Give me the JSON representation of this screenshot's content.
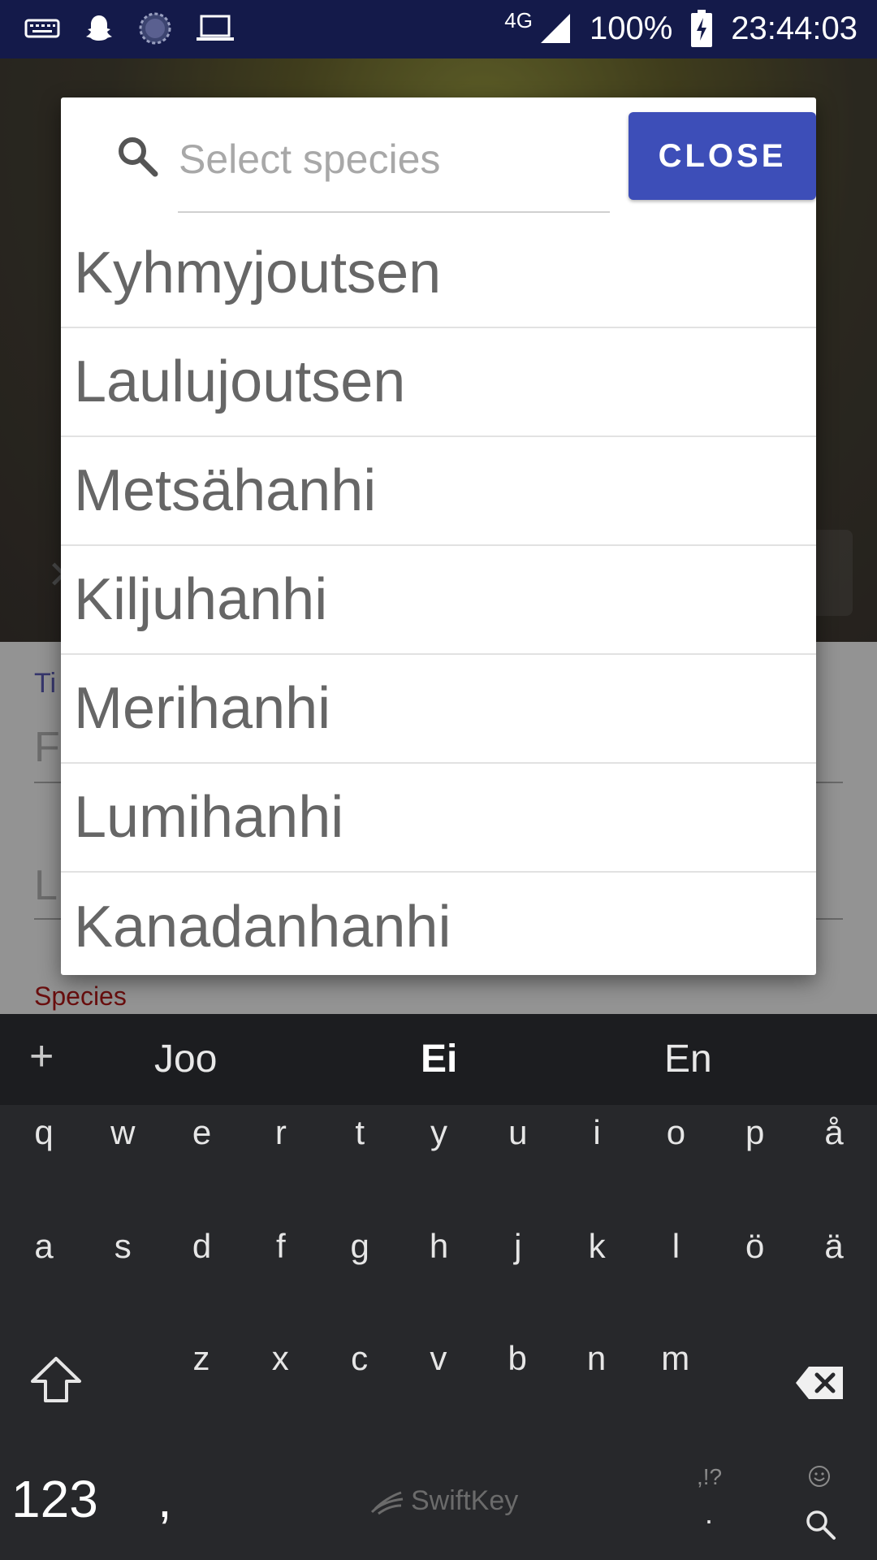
{
  "status_bar": {
    "icons_left": [
      "keyboard-icon",
      "snapchat-icon",
      "loading-icon",
      "laptop-icon"
    ],
    "network": "4G",
    "battery": "100%",
    "time": "23:44:03"
  },
  "background": {
    "form_label": "Ti",
    "field1_partial": "F",
    "field2_partial": "L",
    "species_label": "Species"
  },
  "dialog": {
    "search_placeholder": "Select species",
    "close_label": "CLOSE",
    "species": [
      "Kyhmyjoutsen",
      "Laulujoutsen",
      "Metsähanhi",
      "Kiljuhanhi",
      "Merihanhi",
      "Lumihanhi",
      "Kanadanhanhi"
    ]
  },
  "keyboard": {
    "suggestions": [
      "Joo",
      "Ei",
      "En"
    ],
    "row1": [
      "q",
      "w",
      "e",
      "r",
      "t",
      "y",
      "u",
      "i",
      "o",
      "p",
      "å"
    ],
    "row2": [
      "a",
      "s",
      "d",
      "f",
      "g",
      "h",
      "j",
      "k",
      "l",
      "ö",
      "ä"
    ],
    "row3": [
      "z",
      "x",
      "c",
      "v",
      "b",
      "n",
      "m"
    ],
    "numbers_key": "123",
    "comma_key": ",",
    "brand": "SwiftKey",
    "punct_key": ",!?",
    "period_key": "."
  },
  "colors": {
    "status_bar": "#141a4a",
    "close_button": "#3d4eb8",
    "species_label": "#9b1515",
    "keyboard": "#27282b"
  }
}
